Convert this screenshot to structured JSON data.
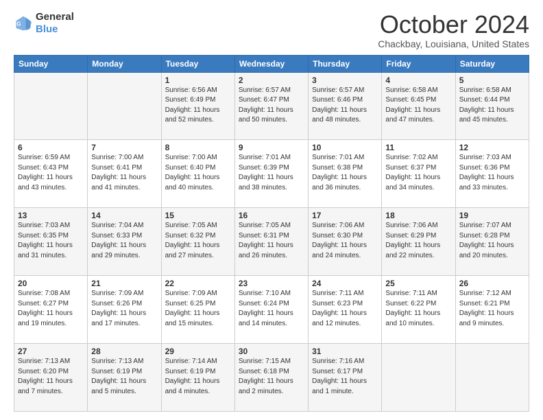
{
  "header": {
    "logo_line1": "General",
    "logo_line2": "Blue",
    "month_title": "October 2024",
    "location": "Chackbay, Louisiana, United States"
  },
  "weekdays": [
    "Sunday",
    "Monday",
    "Tuesday",
    "Wednesday",
    "Thursday",
    "Friday",
    "Saturday"
  ],
  "weeks": [
    [
      {
        "day": "",
        "info": ""
      },
      {
        "day": "",
        "info": ""
      },
      {
        "day": "1",
        "info": "Sunrise: 6:56 AM\nSunset: 6:49 PM\nDaylight: 11 hours and 52 minutes."
      },
      {
        "day": "2",
        "info": "Sunrise: 6:57 AM\nSunset: 6:47 PM\nDaylight: 11 hours and 50 minutes."
      },
      {
        "day": "3",
        "info": "Sunrise: 6:57 AM\nSunset: 6:46 PM\nDaylight: 11 hours and 48 minutes."
      },
      {
        "day": "4",
        "info": "Sunrise: 6:58 AM\nSunset: 6:45 PM\nDaylight: 11 hours and 47 minutes."
      },
      {
        "day": "5",
        "info": "Sunrise: 6:58 AM\nSunset: 6:44 PM\nDaylight: 11 hours and 45 minutes."
      }
    ],
    [
      {
        "day": "6",
        "info": "Sunrise: 6:59 AM\nSunset: 6:43 PM\nDaylight: 11 hours and 43 minutes."
      },
      {
        "day": "7",
        "info": "Sunrise: 7:00 AM\nSunset: 6:41 PM\nDaylight: 11 hours and 41 minutes."
      },
      {
        "day": "8",
        "info": "Sunrise: 7:00 AM\nSunset: 6:40 PM\nDaylight: 11 hours and 40 minutes."
      },
      {
        "day": "9",
        "info": "Sunrise: 7:01 AM\nSunset: 6:39 PM\nDaylight: 11 hours and 38 minutes."
      },
      {
        "day": "10",
        "info": "Sunrise: 7:01 AM\nSunset: 6:38 PM\nDaylight: 11 hours and 36 minutes."
      },
      {
        "day": "11",
        "info": "Sunrise: 7:02 AM\nSunset: 6:37 PM\nDaylight: 11 hours and 34 minutes."
      },
      {
        "day": "12",
        "info": "Sunrise: 7:03 AM\nSunset: 6:36 PM\nDaylight: 11 hours and 33 minutes."
      }
    ],
    [
      {
        "day": "13",
        "info": "Sunrise: 7:03 AM\nSunset: 6:35 PM\nDaylight: 11 hours and 31 minutes."
      },
      {
        "day": "14",
        "info": "Sunrise: 7:04 AM\nSunset: 6:33 PM\nDaylight: 11 hours and 29 minutes."
      },
      {
        "day": "15",
        "info": "Sunrise: 7:05 AM\nSunset: 6:32 PM\nDaylight: 11 hours and 27 minutes."
      },
      {
        "day": "16",
        "info": "Sunrise: 7:05 AM\nSunset: 6:31 PM\nDaylight: 11 hours and 26 minutes."
      },
      {
        "day": "17",
        "info": "Sunrise: 7:06 AM\nSunset: 6:30 PM\nDaylight: 11 hours and 24 minutes."
      },
      {
        "day": "18",
        "info": "Sunrise: 7:06 AM\nSunset: 6:29 PM\nDaylight: 11 hours and 22 minutes."
      },
      {
        "day": "19",
        "info": "Sunrise: 7:07 AM\nSunset: 6:28 PM\nDaylight: 11 hours and 20 minutes."
      }
    ],
    [
      {
        "day": "20",
        "info": "Sunrise: 7:08 AM\nSunset: 6:27 PM\nDaylight: 11 hours and 19 minutes."
      },
      {
        "day": "21",
        "info": "Sunrise: 7:09 AM\nSunset: 6:26 PM\nDaylight: 11 hours and 17 minutes."
      },
      {
        "day": "22",
        "info": "Sunrise: 7:09 AM\nSunset: 6:25 PM\nDaylight: 11 hours and 15 minutes."
      },
      {
        "day": "23",
        "info": "Sunrise: 7:10 AM\nSunset: 6:24 PM\nDaylight: 11 hours and 14 minutes."
      },
      {
        "day": "24",
        "info": "Sunrise: 7:11 AM\nSunset: 6:23 PM\nDaylight: 11 hours and 12 minutes."
      },
      {
        "day": "25",
        "info": "Sunrise: 7:11 AM\nSunset: 6:22 PM\nDaylight: 11 hours and 10 minutes."
      },
      {
        "day": "26",
        "info": "Sunrise: 7:12 AM\nSunset: 6:21 PM\nDaylight: 11 hours and 9 minutes."
      }
    ],
    [
      {
        "day": "27",
        "info": "Sunrise: 7:13 AM\nSunset: 6:20 PM\nDaylight: 11 hours and 7 minutes."
      },
      {
        "day": "28",
        "info": "Sunrise: 7:13 AM\nSunset: 6:19 PM\nDaylight: 11 hours and 5 minutes."
      },
      {
        "day": "29",
        "info": "Sunrise: 7:14 AM\nSunset: 6:19 PM\nDaylight: 11 hours and 4 minutes."
      },
      {
        "day": "30",
        "info": "Sunrise: 7:15 AM\nSunset: 6:18 PM\nDaylight: 11 hours and 2 minutes."
      },
      {
        "day": "31",
        "info": "Sunrise: 7:16 AM\nSunset: 6:17 PM\nDaylight: 11 hours and 1 minute."
      },
      {
        "day": "",
        "info": ""
      },
      {
        "day": "",
        "info": ""
      }
    ]
  ]
}
